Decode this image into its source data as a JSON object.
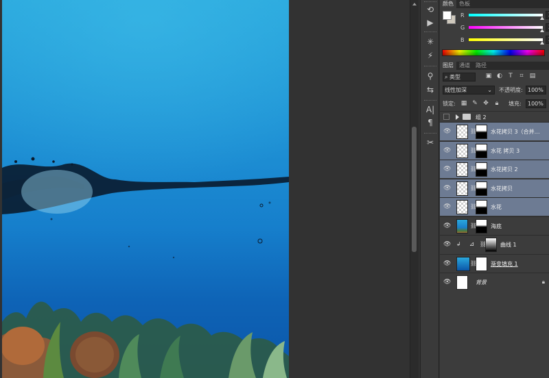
{
  "toolstrip": {
    "tools": [
      {
        "name": "history-icon",
        "glyph": "⟲"
      },
      {
        "name": "play-icon",
        "glyph": "▶"
      },
      {
        "name": "brush-preset-icon",
        "glyph": "✳"
      },
      {
        "name": "brush-icon",
        "glyph": "⚡"
      },
      {
        "name": "clone-source-icon",
        "glyph": "⚲"
      },
      {
        "name": "adjust-icon",
        "glyph": "⇆"
      },
      {
        "name": "character-icon",
        "glyph": "A|"
      },
      {
        "name": "paragraph-icon",
        "glyph": "¶"
      },
      {
        "name": "tools-preset-icon",
        "glyph": "✂"
      }
    ]
  },
  "color_panel": {
    "tabs": [
      "颜色",
      "色板"
    ],
    "sliders": [
      {
        "label": "R",
        "value": "255",
        "track": "linear-gradient(90deg,#00ffff,#ffffff)"
      },
      {
        "label": "G",
        "value": "255",
        "track": "linear-gradient(90deg,#ff00ff,#ffffff)"
      },
      {
        "label": "B",
        "value": "255",
        "track": "linear-gradient(90deg,#ffff00,#ffffff)"
      }
    ]
  },
  "layers_panel": {
    "tabs": [
      "图层",
      "通道",
      "路径"
    ],
    "filter_kind": "类型",
    "blend_mode": "线性加深",
    "opacity_label": "不透明度:",
    "opacity_value": "100%",
    "lock_label": "锁定:",
    "fill_label": "填充:",
    "fill_value": "100%",
    "group_name": "组 2",
    "layers": [
      {
        "name": "水花拷贝 3（合并…",
        "selected": true,
        "has_mask": true,
        "thumb": "checker"
      },
      {
        "name": "水花 拷贝 3",
        "selected": true,
        "has_mask": true,
        "thumb": "checker"
      },
      {
        "name": "水花拷贝 2",
        "selected": true,
        "has_mask": true,
        "thumb": "checker"
      },
      {
        "name": "水花拷贝",
        "selected": true,
        "has_mask": true,
        "thumb": "checker"
      },
      {
        "name": "水花",
        "selected": true,
        "has_mask": true,
        "thumb": "checker"
      },
      {
        "name": "海底",
        "selected": false,
        "has_mask": true,
        "thumb": "seafloor"
      },
      {
        "name": "曲线 1",
        "selected": false,
        "has_mask": true,
        "thumb": "curves"
      },
      {
        "name": "渐变填充 1",
        "selected": false,
        "has_mask": true,
        "thumb": "gradient"
      },
      {
        "name": "背景",
        "selected": false,
        "has_mask": false,
        "thumb": "white",
        "locked": true
      }
    ]
  },
  "colors": {
    "selected_layer": "#6d7b93",
    "panel_bg": "#3c3c3c",
    "canvas_bg": "#323232"
  }
}
